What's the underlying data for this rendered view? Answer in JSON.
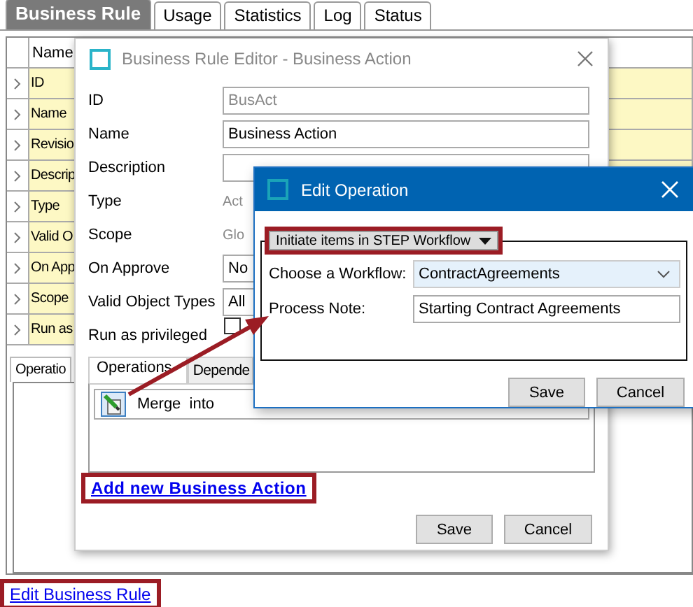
{
  "top_tabs": [
    {
      "label": "Business Rule",
      "selected": true
    },
    {
      "label": "Usage",
      "selected": false
    },
    {
      "label": "Statistics",
      "selected": false
    },
    {
      "label": "Log",
      "selected": false
    },
    {
      "label": "Status",
      "selected": false
    }
  ],
  "table": {
    "column": "Name",
    "rows": [
      "ID",
      "Name",
      "Revisio",
      "Descrip",
      "Type",
      "Valid O",
      "On App",
      "Scope",
      "Run as"
    ]
  },
  "bottom_tab": {
    "label": "Operatio",
    "selected": true
  },
  "edit_link": {
    "label": "Edit Business Rule",
    "highlighted": true
  },
  "editor_dialog": {
    "title": "Business Rule Editor - Business Action",
    "fields": [
      {
        "label": "ID",
        "kind": "input",
        "value": "BusAct",
        "disabled": true
      },
      {
        "label": "Name",
        "kind": "input",
        "value": "Business Action",
        "disabled": false
      },
      {
        "label": "Description",
        "kind": "input"
      },
      {
        "label": "Type",
        "kind": "text",
        "value": "Act"
      },
      {
        "label": "Scope",
        "kind": "text",
        "value": "Glo"
      },
      {
        "label": "On Approve",
        "kind": "select",
        "value": "No"
      },
      {
        "label": "Valid Object Types",
        "kind": "select",
        "value": "All"
      },
      {
        "label": "Run as privileged",
        "kind": "checkbox",
        "checked": false
      }
    ],
    "tabs": [
      {
        "label": "Operations",
        "selected": true
      },
      {
        "label": "Depende",
        "selected": false
      }
    ],
    "operations": [
      {
        "label": "Merge  into"
      }
    ],
    "add_link": {
      "label": "Add new Business Action",
      "highlighted": true
    },
    "buttons": [
      "Save",
      "Cancel"
    ]
  },
  "operation_dialog": {
    "title": "Edit Operation",
    "operation_type": {
      "label": "Initiate items in STEP Workflow",
      "highlighted": true
    },
    "fields": [
      {
        "label": "Choose a Workflow:",
        "kind": "select",
        "value": "ContractAgreements"
      },
      {
        "label": "Process Note:",
        "kind": "input",
        "value": "Starting Contract Agreements"
      }
    ],
    "buttons": [
      "Save",
      "Cancel"
    ]
  }
}
